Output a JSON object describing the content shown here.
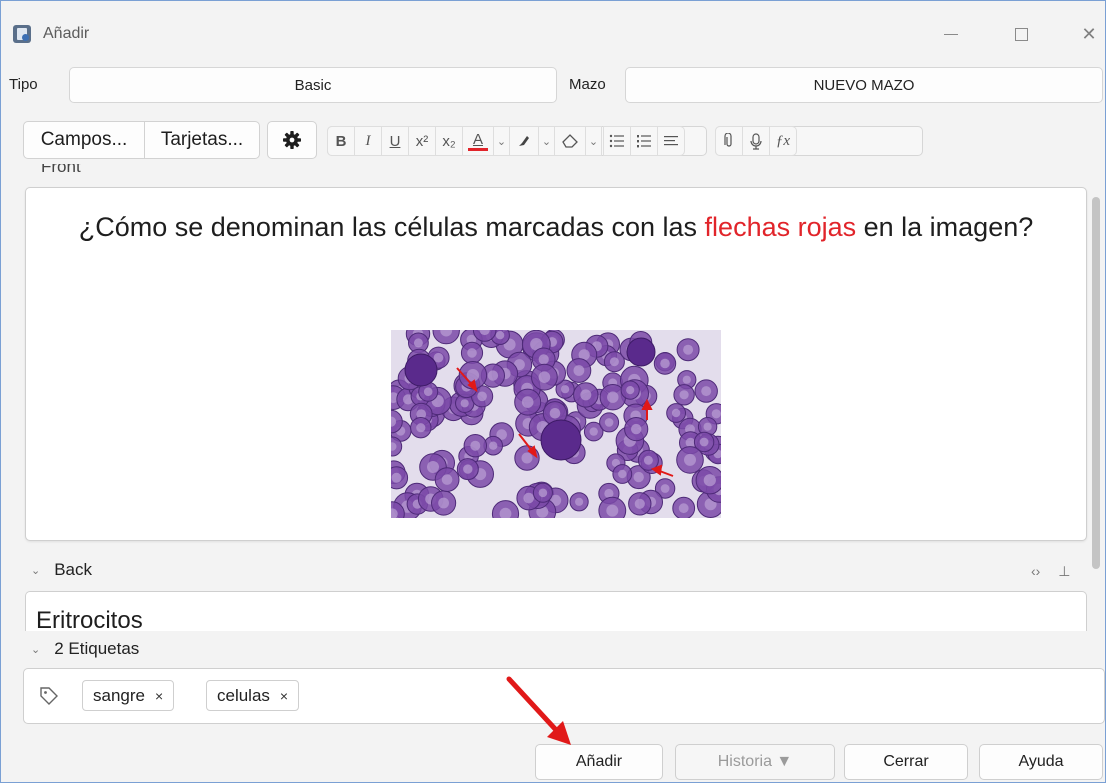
{
  "window": {
    "title": "Añadir",
    "controls": {
      "minimize": "minimize",
      "maximize": "maximize",
      "close": "✕"
    }
  },
  "note_type": {
    "label": "Tipo",
    "value": "Basic"
  },
  "deck": {
    "label": "Mazo",
    "value": "NUEVO MAZO"
  },
  "toolbar": {
    "fields_button": "Campos...",
    "cards_button": "Tarjetas...",
    "icons": [
      "gear-icon",
      "bold-icon",
      "italic-icon",
      "underline-icon",
      "superscript-icon",
      "subscript-icon",
      "text-color-icon",
      "highlight-icon",
      "eraser-icon",
      "bullet-list-icon",
      "numbered-list-icon",
      "align-icon",
      "attach-icon",
      "microphone-icon",
      "formula-icon"
    ],
    "text_color": "#e1242a"
  },
  "front": {
    "label": "Front",
    "question_before": "¿Cómo se denominan las células marcadas con las ",
    "question_highlight": "flechas rojas",
    "question_after": " en la imagen?",
    "highlight_color": "#e1242a"
  },
  "back": {
    "label": "Back",
    "value": "Eritrocitos"
  },
  "tags": {
    "header": "2 Etiquetas",
    "items": [
      {
        "label": "sangre",
        "remove": "×"
      },
      {
        "label": "celulas",
        "remove": "×"
      }
    ]
  },
  "buttons": {
    "add": "Añadir",
    "history": "Historia ▼",
    "close": "Cerrar",
    "help": "Ayuda"
  },
  "colors": {
    "annotation_arrow": "#e11919",
    "cell_stain": "#7b4aa8"
  }
}
